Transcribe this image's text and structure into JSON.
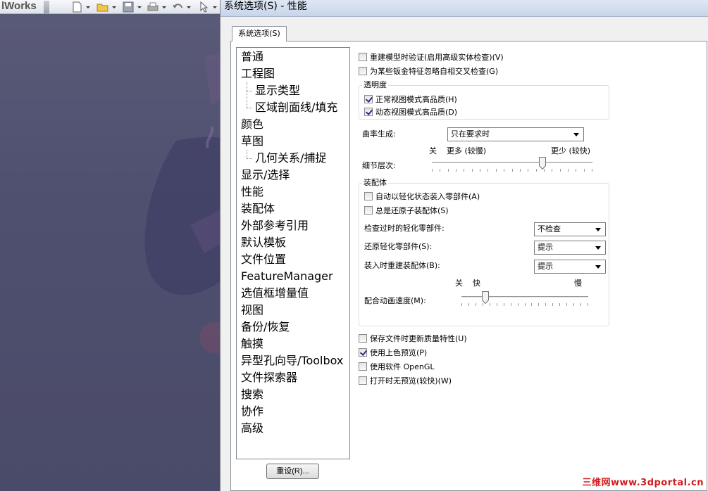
{
  "background_app": {
    "title": "lWorks"
  },
  "dialog": {
    "title": "系统选项(S) - 性能",
    "tab_label": "系统选项(S)",
    "reset_label": "重设(R)..."
  },
  "categories": [
    {
      "label": "普通",
      "level": 0
    },
    {
      "label": "工程图",
      "level": 0
    },
    {
      "label": "显示类型",
      "level": 1
    },
    {
      "label": "区域剖面线/填充",
      "level": 1
    },
    {
      "label": "颜色",
      "level": 0
    },
    {
      "label": "草图",
      "level": 0
    },
    {
      "label": "几何关系/捕捉",
      "level": 1
    },
    {
      "label": "显示/选择",
      "level": 0
    },
    {
      "label": "性能",
      "level": 0
    },
    {
      "label": "装配体",
      "level": 0
    },
    {
      "label": "外部参考引用",
      "level": 0
    },
    {
      "label": "默认模板",
      "level": 0
    },
    {
      "label": "文件位置",
      "level": 0
    },
    {
      "label": "FeatureManager",
      "level": 0
    },
    {
      "label": "选值框增量值",
      "level": 0
    },
    {
      "label": "视图",
      "level": 0
    },
    {
      "label": "备份/恢复",
      "level": 0
    },
    {
      "label": "触摸",
      "level": 0
    },
    {
      "label": "异型孔向导/Toolbox",
      "level": 0
    },
    {
      "label": "文件探索器",
      "level": 0
    },
    {
      "label": "搜索",
      "level": 0
    },
    {
      "label": "协作",
      "level": 0
    },
    {
      "label": "高级",
      "level": 0
    }
  ],
  "performance": {
    "verify_rebuild": {
      "label": "重建模型时验证(启用高级实体检查)(V)",
      "checked": false
    },
    "ignore_sheetmetal": {
      "label": "为某些钣金特征忽略自相交叉检查(G)",
      "checked": false
    },
    "transparency": {
      "title": "透明度",
      "normal_view": {
        "label": "正常视图模式高品质(H)",
        "checked": true
      },
      "dynamic_view": {
        "label": "动态视图模式高品质(D)",
        "checked": true
      }
    },
    "curvature": {
      "label": "曲率生成:",
      "value": "只在要求时"
    },
    "level_of_detail": {
      "label": "细节层次:",
      "off_label": "关",
      "more_label": "更多 (较慢)",
      "less_label": "更少 (较快)",
      "level": 0.69
    },
    "assemblies": {
      "title": "装配体",
      "auto_lightweight": {
        "label": "自动以轻化状态装入零部件(A)",
        "checked": false
      },
      "always_resolve": {
        "label": "总是还原子装配体(S)",
        "checked": false
      },
      "check_outdated": {
        "label": "检查过时的轻化零部件:",
        "value": "不检查"
      },
      "resolve_lightweight": {
        "label": "还原轻化零部件(S):",
        "value": "提示"
      },
      "rebuild_on_load": {
        "label": "装入时重建装配体(B):",
        "value": "提示"
      },
      "mate_animation": {
        "label": "配合动画速度(M):",
        "off_label": "关",
        "fast_label": "快",
        "slow_label": "慢",
        "level": 0.19
      }
    },
    "save_mass_props": {
      "label": "保存文件时更新质量特性(U)",
      "checked": false
    },
    "use_shaded_preview": {
      "label": "使用上色预览(P)",
      "checked": true
    },
    "use_software_opengl": {
      "label": "使用软件 OpenGL",
      "checked": false
    },
    "no_preview_on_open": {
      "label": "打开时无预览(较快)(W)",
      "checked": false
    }
  },
  "watermark": "三维网www.3dportal.cn",
  "colors": {
    "dialog_bg": "#f0f0f0",
    "panel_bg": "#ffffff",
    "watermark": "#d31d1d",
    "background_app": "#4f5070"
  }
}
